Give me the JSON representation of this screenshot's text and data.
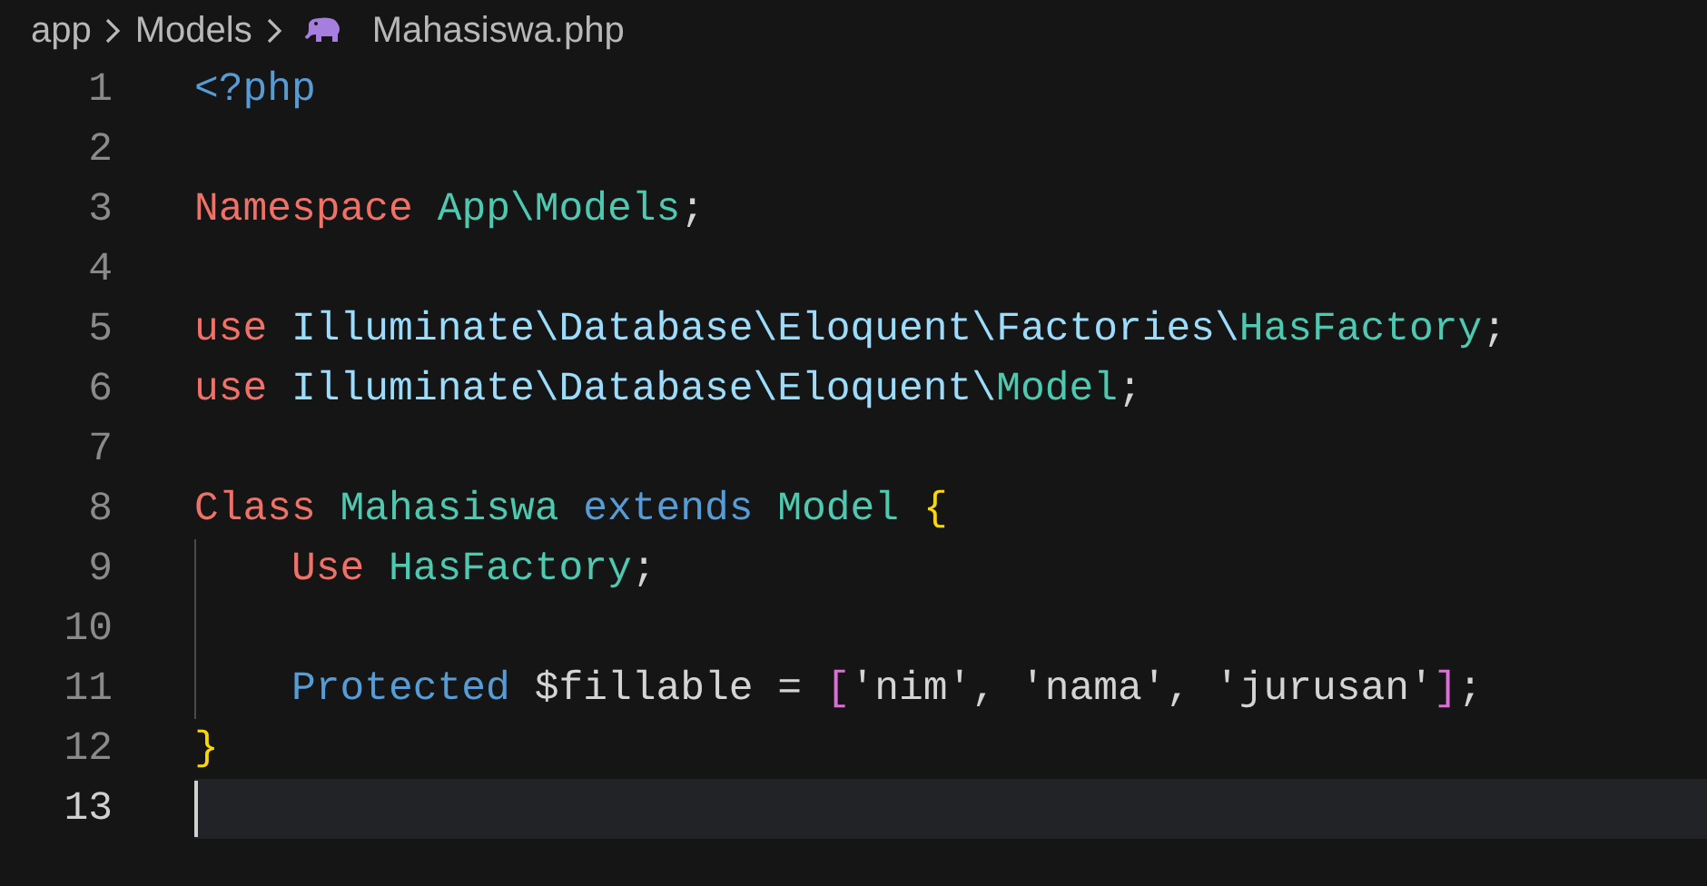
{
  "breadcrumb": [
    {
      "label": "app",
      "kind": "folder"
    },
    {
      "label": "Models",
      "kind": "folder"
    },
    {
      "label": "Mahasiswa.php",
      "kind": "php-file"
    }
  ],
  "lines": [
    {
      "number": "1",
      "current": false,
      "tokens": [
        {
          "text": "<?php",
          "kind": "tag"
        }
      ]
    },
    {
      "number": "2",
      "current": false
    },
    {
      "number": "3",
      "current": false,
      "tokens": [
        {
          "text": "Namespace",
          "kind": "keyword"
        },
        {
          "text": " App\\Models",
          "kind": "type"
        },
        {
          "text": ";",
          "kind": "plain"
        }
      ]
    },
    {
      "number": "4",
      "current": false
    },
    {
      "number": "5",
      "current": false,
      "tokens": [
        {
          "text": "use",
          "kind": "keyword"
        },
        {
          "text": " Illuminate\\Database\\Eloquent\\Factories\\",
          "kind": "namespace"
        },
        {
          "text": "HasFactory",
          "kind": "type"
        },
        {
          "text": ";",
          "kind": "plain"
        }
      ]
    },
    {
      "number": "6",
      "current": false,
      "tokens": [
        {
          "text": "use",
          "kind": "keyword"
        },
        {
          "text": " Illuminate\\Database\\Eloquent\\",
          "kind": "namespace"
        },
        {
          "text": "Model",
          "kind": "type"
        },
        {
          "text": ";",
          "kind": "plain"
        }
      ]
    },
    {
      "number": "7",
      "current": false
    },
    {
      "number": "8",
      "current": false,
      "tokens": [
        {
          "text": "Class",
          "kind": "keyword"
        },
        {
          "text": " Mahasiswa",
          "kind": "type"
        },
        {
          "text": " extends",
          "kind": "storage"
        },
        {
          "text": " Model",
          "kind": "type"
        },
        {
          "text": " {",
          "kind": "bracket1"
        }
      ]
    },
    {
      "number": "9",
      "indented": true,
      "current": false,
      "tokens": [
        {
          "text": "Use",
          "kind": "keyword"
        },
        {
          "text": " HasFactory",
          "kind": "type"
        },
        {
          "text": ";",
          "kind": "plain"
        }
      ]
    },
    {
      "number": "10",
      "indented": true,
      "current": false
    },
    {
      "number": "11",
      "indented": true,
      "current": false,
      "tokens": [
        {
          "text": "Protected",
          "kind": "storage"
        },
        {
          "text": " $fillable = ",
          "kind": "plain"
        },
        {
          "text": "[",
          "kind": "bracket2"
        },
        {
          "text": "'nim', 'nama', 'jurusan'",
          "kind": "plain"
        },
        {
          "text": "]",
          "kind": "bracket2"
        },
        {
          "text": ";",
          "kind": "plain"
        }
      ]
    },
    {
      "number": "12",
      "current": false,
      "tokens": [
        {
          "text": "}",
          "kind": "bracket1"
        }
      ]
    },
    {
      "number": "13",
      "current": true
    }
  ]
}
